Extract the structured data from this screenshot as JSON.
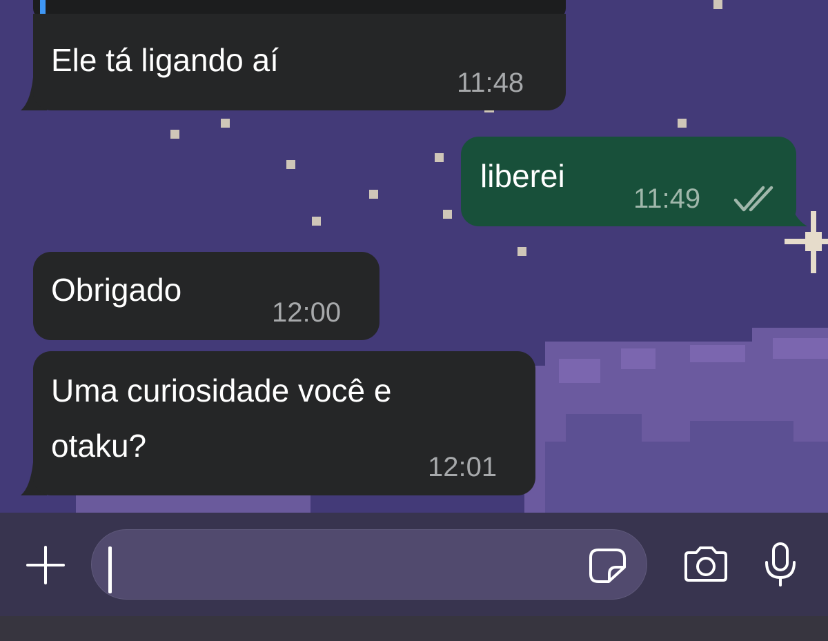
{
  "theme": {
    "incoming_bubble": "#252627",
    "outgoing_bubble": "#18503a",
    "wallpaper": "#433a78",
    "reply_accent": "#3f97f5"
  },
  "messages": [
    {
      "direction": "incoming",
      "lines": [
        "Ele tá ligando aí"
      ],
      "time": "11:48"
    },
    {
      "direction": "outgoing",
      "lines": [
        "liberei"
      ],
      "time": "11:49",
      "status": "read-double-check"
    },
    {
      "direction": "incoming",
      "lines": [
        "Obrigado"
      ],
      "time": "12:00"
    },
    {
      "direction": "incoming",
      "lines": [
        "Uma curiosidade você e",
        "otaku?"
      ],
      "time": "12:01"
    }
  ],
  "composer": {
    "input_value": "",
    "icons": [
      "plus-icon",
      "sticker-icon",
      "camera-icon",
      "microphone-icon"
    ]
  }
}
